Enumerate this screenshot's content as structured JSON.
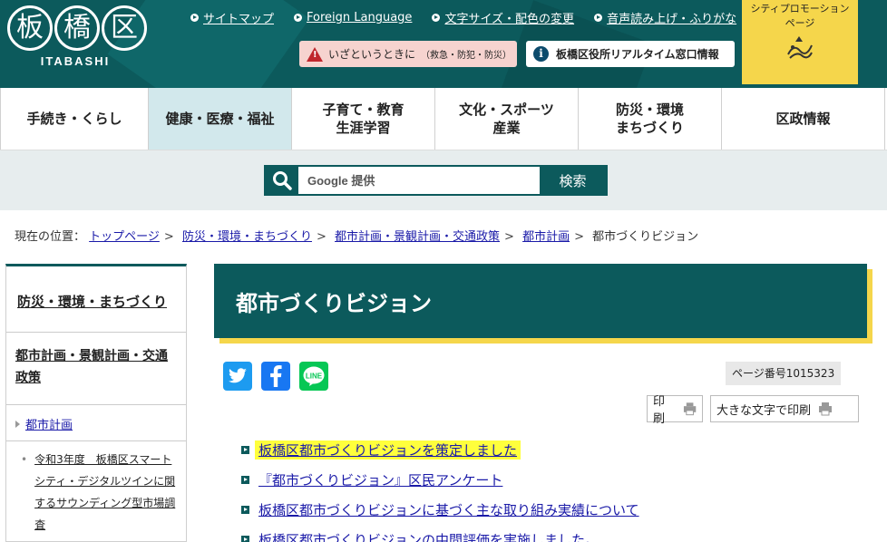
{
  "header": {
    "logo_kanji": [
      "板",
      "橋",
      "区"
    ],
    "logo_latin": "ITABASHI",
    "top_links": [
      {
        "label": "サイトマップ"
      },
      {
        "label": "Foreign Language"
      },
      {
        "label": "文字サイズ・配色の変更"
      },
      {
        "label": "音声読み上げ・ふりがな"
      }
    ],
    "emergency_button": {
      "label": "いざというときに",
      "sub": "（救急・防犯・防災）"
    },
    "realtime_button": {
      "label": "板橋区役所リアルタイム窓口情報"
    },
    "promo": {
      "line1": "シティプロモーション",
      "line2": "ページ"
    }
  },
  "global_nav": [
    {
      "label": "手続き・くらし",
      "line2": ""
    },
    {
      "label": "健康・医療・福祉",
      "line2": ""
    },
    {
      "label": "子育て・教育",
      "line2": "生涯学習"
    },
    {
      "label": "文化・スポーツ",
      "line2": "産業"
    },
    {
      "label": "防災・環境",
      "line2": "まちづくり"
    },
    {
      "label": "区政情報",
      "line2": ""
    }
  ],
  "search": {
    "placeholder": "Google 提供",
    "submit_label": "検索"
  },
  "breadcrumb": {
    "prefix": "現在の位置：",
    "items": [
      "トップページ",
      "防災・環境・まちづくり",
      "都市計画・景観計画・交通政策",
      "都市計画"
    ],
    "current": "都市づくりビジョン"
  },
  "sidebar": {
    "title": "防災・環境・まちづくり",
    "category": "都市計画・景観計画・交通政策",
    "sub": "都市計画",
    "subsub": "令和3年度　板橋区スマートシティ・デジタルツインに関するサウンディング型市場調査"
  },
  "main": {
    "title": "都市づくりビジョン",
    "page_number": "ページ番号1015323",
    "print_label": "印刷",
    "print_large_label": "大きな文字で印刷",
    "links": [
      "板橋区都市づくりビジョンを策定しました",
      "『都市づくりビジョン』区民アンケート",
      "板橋区都市づくりビジョンに基づく主な取り組み実績について",
      "板橋区都市づくりビジョンの中間評価を実施しました。"
    ]
  },
  "colors": {
    "brand": "#0c5a5c",
    "accent": "#f5d64b",
    "nav_active": "#d2e8ec",
    "link": "#1a1aa8",
    "highlight": "#ffff3c"
  },
  "icons": [
    "search-icon",
    "warning-icon",
    "info-icon",
    "twitter-icon",
    "facebook-icon",
    "line-icon",
    "printer-icon",
    "promo-icon"
  ]
}
